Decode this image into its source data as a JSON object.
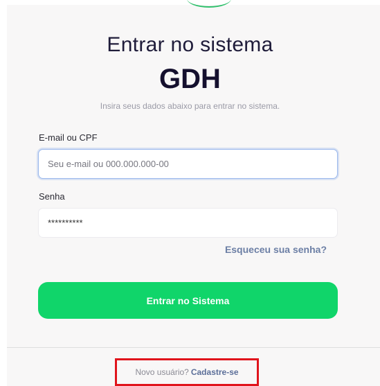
{
  "header": {
    "title": "Entrar no sistema",
    "brand": "GDH",
    "subtitle": "Insira seus dados abaixo para entrar no sistema."
  },
  "form": {
    "email_label": "E-mail ou CPF",
    "email_placeholder": "Seu e-mail ou 000.000.000-00",
    "email_value": "",
    "password_label": "Senha",
    "password_value": "**********",
    "forgot_link": "Esqueceu sua senha?",
    "submit_label": "Entrar no Sistema"
  },
  "footer": {
    "signup_question": "Novo usuário?",
    "signup_link": "Cadastre-se"
  },
  "colors": {
    "accent": "#10d56a",
    "link": "#6c7fa5",
    "highlight": "#e0141c"
  }
}
